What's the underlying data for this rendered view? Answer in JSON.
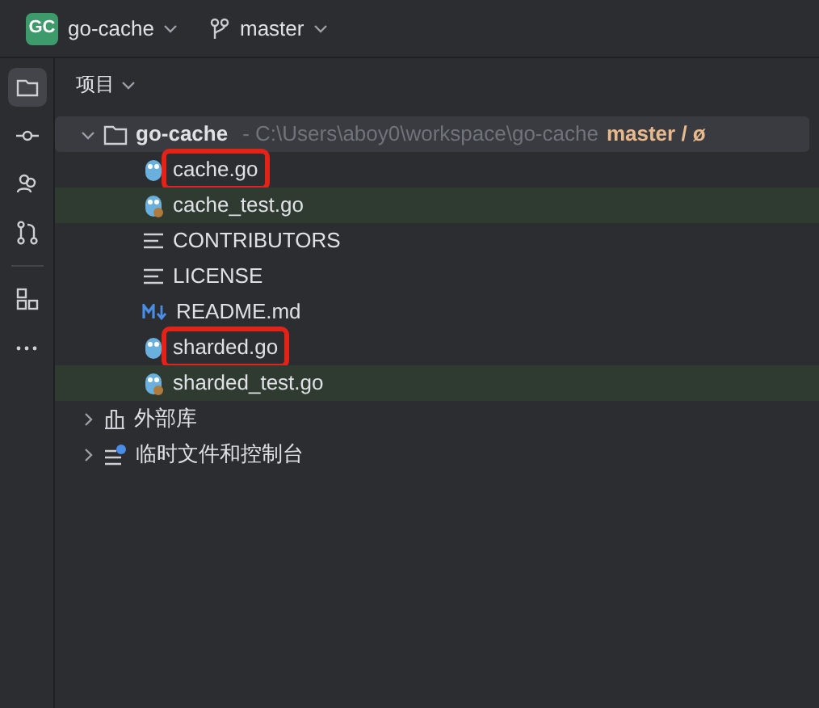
{
  "toolbar": {
    "project_badge": "GC",
    "project_name": "go-cache",
    "branch": "master"
  },
  "rail": [
    {
      "selected": true
    },
    {
      "selected": false
    },
    {
      "selected": false
    },
    {
      "selected": false
    },
    {
      "selected": false
    },
    {
      "selected": false
    }
  ],
  "panel": {
    "title": "项目"
  },
  "tree": [
    {
      "name": "go-cache",
      "kind": "folder",
      "path": "- C:\\Users\\aboy0\\workspace\\go-cache",
      "branch": "master / ø",
      "expanded": true,
      "selected": true,
      "children": [
        {
          "name": "cache.go",
          "kind": "go",
          "tinted": false,
          "highlighted": true
        },
        {
          "name": "cache_test.go",
          "kind": "gotest",
          "tinted": true,
          "highlighted": false
        },
        {
          "name": "CONTRIBUTORS",
          "kind": "text",
          "tinted": false,
          "highlighted": false
        },
        {
          "name": "LICENSE",
          "kind": "text",
          "tinted": false,
          "highlighted": false
        },
        {
          "name": "README.md",
          "kind": "markdown",
          "tinted": false,
          "highlighted": false
        },
        {
          "name": "sharded.go",
          "kind": "go",
          "tinted": false,
          "highlighted": true
        },
        {
          "name": "sharded_test.go",
          "kind": "gotest",
          "tinted": true,
          "highlighted": false
        }
      ]
    },
    {
      "name": "外部库",
      "kind": "library",
      "expanded": false,
      "selected": false
    },
    {
      "name": "临时文件和控制台",
      "kind": "scratch",
      "expanded": false,
      "selected": false
    }
  ]
}
